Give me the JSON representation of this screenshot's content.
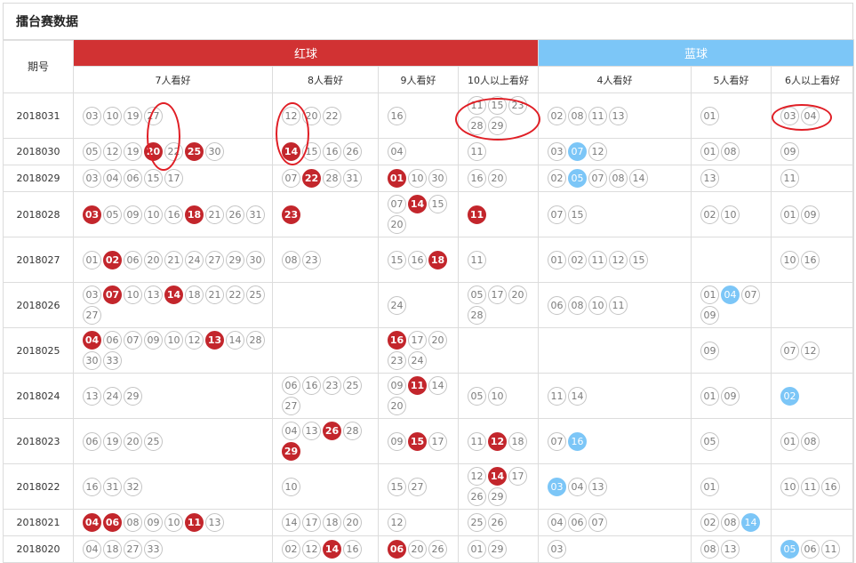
{
  "title": "擂台赛数据",
  "header": {
    "period": "期号",
    "red_group": "红球",
    "blue_group": "蓝球",
    "red_cols": [
      "7人看好",
      "8人看好",
      "9人看好",
      "10人以上看好"
    ],
    "blue_cols": [
      "4人看好",
      "5人看好",
      "6人以上看好"
    ]
  },
  "colors": {
    "red_header": "#d13233",
    "blue_header": "#7cc6f7",
    "hit_red": "#c3262c",
    "hit_blue": "#7cc6f7"
  },
  "rows": [
    {
      "period": "2018031",
      "cells": [
        [
          {
            "n": "03"
          },
          {
            "n": "10"
          },
          {
            "n": "19"
          },
          {
            "n": "27"
          }
        ],
        [
          {
            "n": "12"
          },
          {
            "n": "20"
          },
          {
            "n": "22"
          }
        ],
        [
          {
            "n": "16"
          }
        ],
        [
          {
            "n": "11"
          },
          {
            "n": "15"
          },
          {
            "n": "23"
          },
          {
            "n": "28"
          },
          {
            "n": "29"
          }
        ],
        [
          {
            "n": "02"
          },
          {
            "n": "08"
          },
          {
            "n": "11"
          },
          {
            "n": "13"
          }
        ],
        [
          {
            "n": "01"
          }
        ],
        [
          {
            "n": "03"
          },
          {
            "n": "04"
          }
        ]
      ]
    },
    {
      "period": "2018030",
      "cells": [
        [
          {
            "n": "05"
          },
          {
            "n": "12"
          },
          {
            "n": "19"
          },
          {
            "n": "20",
            "h": 1
          },
          {
            "n": "22"
          },
          {
            "n": "25",
            "h": 1
          },
          {
            "n": "30"
          }
        ],
        [
          {
            "n": "14",
            "h": 1
          },
          {
            "n": "15"
          },
          {
            "n": "16"
          },
          {
            "n": "26"
          }
        ],
        [
          {
            "n": "04"
          }
        ],
        [
          {
            "n": "11"
          }
        ],
        [
          {
            "n": "03"
          },
          {
            "n": "07",
            "h": 2
          },
          {
            "n": "12"
          }
        ],
        [
          {
            "n": "01"
          },
          {
            "n": "08"
          }
        ],
        [
          {
            "n": "09"
          }
        ]
      ]
    },
    {
      "period": "2018029",
      "cells": [
        [
          {
            "n": "03"
          },
          {
            "n": "04"
          },
          {
            "n": "06"
          },
          {
            "n": "15"
          },
          {
            "n": "17"
          }
        ],
        [
          {
            "n": "07"
          },
          {
            "n": "22",
            "h": 1
          },
          {
            "n": "28"
          },
          {
            "n": "31"
          }
        ],
        [
          {
            "n": "01",
            "h": 1
          },
          {
            "n": "10"
          },
          {
            "n": "30"
          }
        ],
        [
          {
            "n": "16"
          },
          {
            "n": "20"
          }
        ],
        [
          {
            "n": "02"
          },
          {
            "n": "05",
            "h": 2
          },
          {
            "n": "07"
          },
          {
            "n": "08"
          },
          {
            "n": "14"
          }
        ],
        [
          {
            "n": "13"
          }
        ],
        [
          {
            "n": "11"
          }
        ]
      ]
    },
    {
      "period": "2018028",
      "cells": [
        [
          {
            "n": "03",
            "h": 1
          },
          {
            "n": "05"
          },
          {
            "n": "09"
          },
          {
            "n": "10"
          },
          {
            "n": "16"
          },
          {
            "n": "18",
            "h": 1
          },
          {
            "n": "21"
          },
          {
            "n": "26"
          },
          {
            "n": "31"
          }
        ],
        [
          {
            "n": "23",
            "h": 1
          }
        ],
        [
          {
            "n": "07"
          },
          {
            "n": "14",
            "h": 1
          },
          {
            "n": "15"
          },
          {
            "n": "20"
          }
        ],
        [
          {
            "n": "11",
            "h": 1
          }
        ],
        [
          {
            "n": "07"
          },
          {
            "n": "15"
          }
        ],
        [
          {
            "n": "02"
          },
          {
            "n": "10"
          }
        ],
        [
          {
            "n": "01"
          },
          {
            "n": "09"
          }
        ]
      ]
    },
    {
      "period": "2018027",
      "cells": [
        [
          {
            "n": "01"
          },
          {
            "n": "02",
            "h": 1
          },
          {
            "n": "06"
          },
          {
            "n": "20"
          },
          {
            "n": "21"
          },
          {
            "n": "24"
          },
          {
            "n": "27"
          },
          {
            "n": "29"
          },
          {
            "n": "30"
          }
        ],
        [
          {
            "n": "08"
          },
          {
            "n": "23"
          }
        ],
        [
          {
            "n": "15"
          },
          {
            "n": "16"
          },
          {
            "n": "18",
            "h": 1
          }
        ],
        [
          {
            "n": "11"
          }
        ],
        [
          {
            "n": "01"
          },
          {
            "n": "02"
          },
          {
            "n": "11"
          },
          {
            "n": "12"
          },
          {
            "n": "15"
          }
        ],
        [],
        [
          {
            "n": "10"
          },
          {
            "n": "16"
          }
        ]
      ]
    },
    {
      "period": "2018026",
      "cells": [
        [
          {
            "n": "03"
          },
          {
            "n": "07",
            "h": 1
          },
          {
            "n": "10"
          },
          {
            "n": "13"
          },
          {
            "n": "14",
            "h": 1
          },
          {
            "n": "18"
          },
          {
            "n": "21"
          },
          {
            "n": "22"
          },
          {
            "n": "25"
          },
          {
            "n": "27"
          }
        ],
        [],
        [
          {
            "n": "24"
          }
        ],
        [
          {
            "n": "05"
          },
          {
            "n": "17"
          },
          {
            "n": "20"
          },
          {
            "n": "28"
          }
        ],
        [
          {
            "n": "06"
          },
          {
            "n": "08"
          },
          {
            "n": "10"
          },
          {
            "n": "11"
          }
        ],
        [
          {
            "n": "01"
          },
          {
            "n": "04",
            "h": 2
          },
          {
            "n": "07"
          },
          {
            "n": "09"
          }
        ],
        []
      ]
    },
    {
      "period": "2018025",
      "cells": [
        [
          {
            "n": "04",
            "h": 1
          },
          {
            "n": "06"
          },
          {
            "n": "07"
          },
          {
            "n": "09"
          },
          {
            "n": "10"
          },
          {
            "n": "12"
          },
          {
            "n": "13",
            "h": 1
          },
          {
            "n": "14"
          },
          {
            "n": "28"
          },
          {
            "n": "30"
          },
          {
            "n": "33"
          }
        ],
        [],
        [
          {
            "n": "16",
            "h": 1
          },
          {
            "n": "17"
          },
          {
            "n": "20"
          },
          {
            "n": "23"
          },
          {
            "n": "24"
          }
        ],
        [],
        [],
        [
          {
            "n": "09"
          }
        ],
        [
          {
            "n": "07"
          },
          {
            "n": "12"
          }
        ]
      ]
    },
    {
      "period": "2018024",
      "cells": [
        [
          {
            "n": "13"
          },
          {
            "n": "24"
          },
          {
            "n": "29"
          }
        ],
        [
          {
            "n": "06"
          },
          {
            "n": "16"
          },
          {
            "n": "23"
          },
          {
            "n": "25"
          },
          {
            "n": "27"
          }
        ],
        [
          {
            "n": "09"
          },
          {
            "n": "11",
            "h": 1
          },
          {
            "n": "14"
          },
          {
            "n": "20"
          }
        ],
        [
          {
            "n": "05"
          },
          {
            "n": "10"
          }
        ],
        [
          {
            "n": "11"
          },
          {
            "n": "14"
          }
        ],
        [
          {
            "n": "01"
          },
          {
            "n": "09"
          }
        ],
        [
          {
            "n": "02",
            "h": 2
          }
        ]
      ]
    },
    {
      "period": "2018023",
      "cells": [
        [
          {
            "n": "06"
          },
          {
            "n": "19"
          },
          {
            "n": "20"
          },
          {
            "n": "25"
          }
        ],
        [
          {
            "n": "04"
          },
          {
            "n": "13"
          },
          {
            "n": "26",
            "h": 1
          },
          {
            "n": "28"
          },
          {
            "n": "29",
            "h": 1
          }
        ],
        [
          {
            "n": "09"
          },
          {
            "n": "15",
            "h": 1
          },
          {
            "n": "17"
          }
        ],
        [
          {
            "n": "11"
          },
          {
            "n": "12",
            "h": 1
          },
          {
            "n": "18"
          }
        ],
        [
          {
            "n": "07"
          },
          {
            "n": "16",
            "h": 2
          }
        ],
        [
          {
            "n": "05"
          }
        ],
        [
          {
            "n": "01"
          },
          {
            "n": "08"
          }
        ]
      ]
    },
    {
      "period": "2018022",
      "cells": [
        [
          {
            "n": "16"
          },
          {
            "n": "31"
          },
          {
            "n": "32"
          }
        ],
        [
          {
            "n": "10"
          }
        ],
        [
          {
            "n": "15"
          },
          {
            "n": "27"
          }
        ],
        [
          {
            "n": "12"
          },
          {
            "n": "14",
            "h": 1
          },
          {
            "n": "17"
          },
          {
            "n": "26"
          },
          {
            "n": "29"
          }
        ],
        [
          {
            "n": "03",
            "h": 2
          },
          {
            "n": "04"
          },
          {
            "n": "13"
          }
        ],
        [
          {
            "n": "01"
          }
        ],
        [
          {
            "n": "10"
          },
          {
            "n": "11"
          },
          {
            "n": "16"
          }
        ]
      ]
    },
    {
      "period": "2018021",
      "cells": [
        [
          {
            "n": "04",
            "h": 1
          },
          {
            "n": "06",
            "h": 1
          },
          {
            "n": "08"
          },
          {
            "n": "09"
          },
          {
            "n": "10"
          },
          {
            "n": "11",
            "h": 1
          },
          {
            "n": "13"
          }
        ],
        [
          {
            "n": "14"
          },
          {
            "n": "17"
          },
          {
            "n": "18"
          },
          {
            "n": "20"
          }
        ],
        [
          {
            "n": "12"
          }
        ],
        [
          {
            "n": "25"
          },
          {
            "n": "26"
          }
        ],
        [
          {
            "n": "04"
          },
          {
            "n": "06"
          },
          {
            "n": "07"
          }
        ],
        [
          {
            "n": "02"
          },
          {
            "n": "08"
          },
          {
            "n": "14",
            "h": 2
          }
        ],
        []
      ]
    },
    {
      "period": "2018020",
      "cells": [
        [
          {
            "n": "04"
          },
          {
            "n": "18"
          },
          {
            "n": "27"
          },
          {
            "n": "33"
          }
        ],
        [
          {
            "n": "02"
          },
          {
            "n": "12"
          },
          {
            "n": "14",
            "h": 1
          },
          {
            "n": "16"
          }
        ],
        [
          {
            "n": "06",
            "h": 1
          },
          {
            "n": "20"
          },
          {
            "n": "26"
          }
        ],
        [
          {
            "n": "01"
          },
          {
            "n": "29"
          }
        ],
        [
          {
            "n": "03"
          }
        ],
        [
          {
            "n": "08"
          },
          {
            "n": "13"
          }
        ],
        [
          {
            "n": "05",
            "h": 2
          },
          {
            "n": "06"
          },
          {
            "n": "11"
          }
        ]
      ]
    }
  ]
}
